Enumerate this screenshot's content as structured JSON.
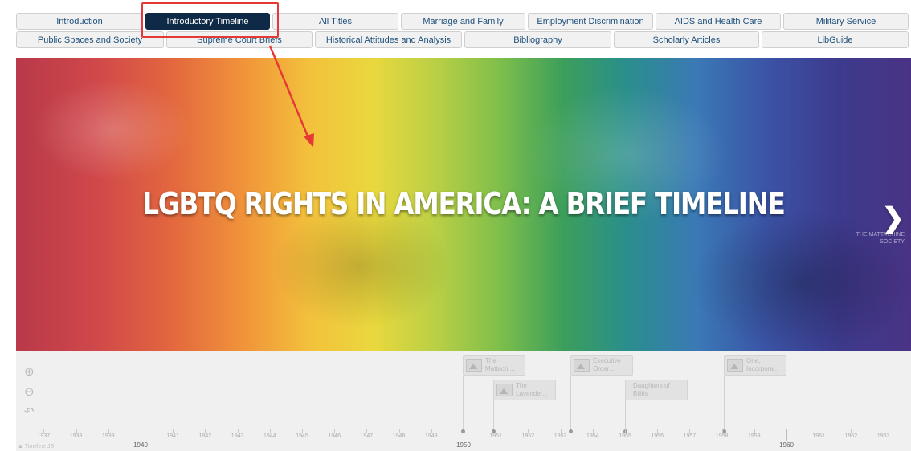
{
  "tabs_row1": [
    {
      "label": "Introduction",
      "active": false
    },
    {
      "label": "Introductory Timeline",
      "active": true
    },
    {
      "label": "All Titles",
      "active": false
    },
    {
      "label": "Marriage and Family",
      "active": false
    },
    {
      "label": "Employment Discrimination",
      "active": false
    },
    {
      "label": "AIDS and Health Care",
      "active": false
    },
    {
      "label": "Military Service",
      "active": false
    }
  ],
  "tabs_row2": [
    {
      "label": "Public Spaces and Society"
    },
    {
      "label": "Supreme Court Briefs"
    },
    {
      "label": "Historical Attitudes and Analysis"
    },
    {
      "label": "Bibliography"
    },
    {
      "label": "Scholarly Articles"
    },
    {
      "label": "LibGuide"
    }
  ],
  "hero": {
    "title": "LGBTQ RIGHTS IN AMERICA: A BRIEF TIMELINE",
    "next_icon": "chevron-right-icon",
    "credit_line1": "THE MATTACHINE",
    "credit_line2": "SOCIETY"
  },
  "timeline": {
    "zoom_in_icon": "zoom-in-icon",
    "zoom_out_icon": "zoom-out-icon",
    "back_icon": "back-to-start-icon",
    "markers": [
      {
        "line1": "The",
        "line2": "Mattachi...",
        "has_image": true
      },
      {
        "line1": "The",
        "line2": "Lavender...",
        "has_image": true
      },
      {
        "line1": "Executive",
        "line2": "Order...",
        "has_image": true
      },
      {
        "line1": "Daughters of",
        "line2": "Bilitis",
        "has_image": false
      },
      {
        "line1": "One,",
        "line2": "Incorpora...",
        "has_image": true
      }
    ],
    "years": [
      "1937",
      "1938",
      "1939",
      "1941",
      "1942",
      "1943",
      "1944",
      "1945",
      "1946",
      "1947",
      "1948",
      "1949",
      "1951",
      "1952",
      "1953",
      "1954",
      "1955",
      "1956",
      "1957",
      "1958",
      "1959",
      "1961",
      "1962",
      "1963"
    ],
    "decades": [
      "1940",
      "1950",
      "1960"
    ],
    "brand": "Timeline JS"
  }
}
